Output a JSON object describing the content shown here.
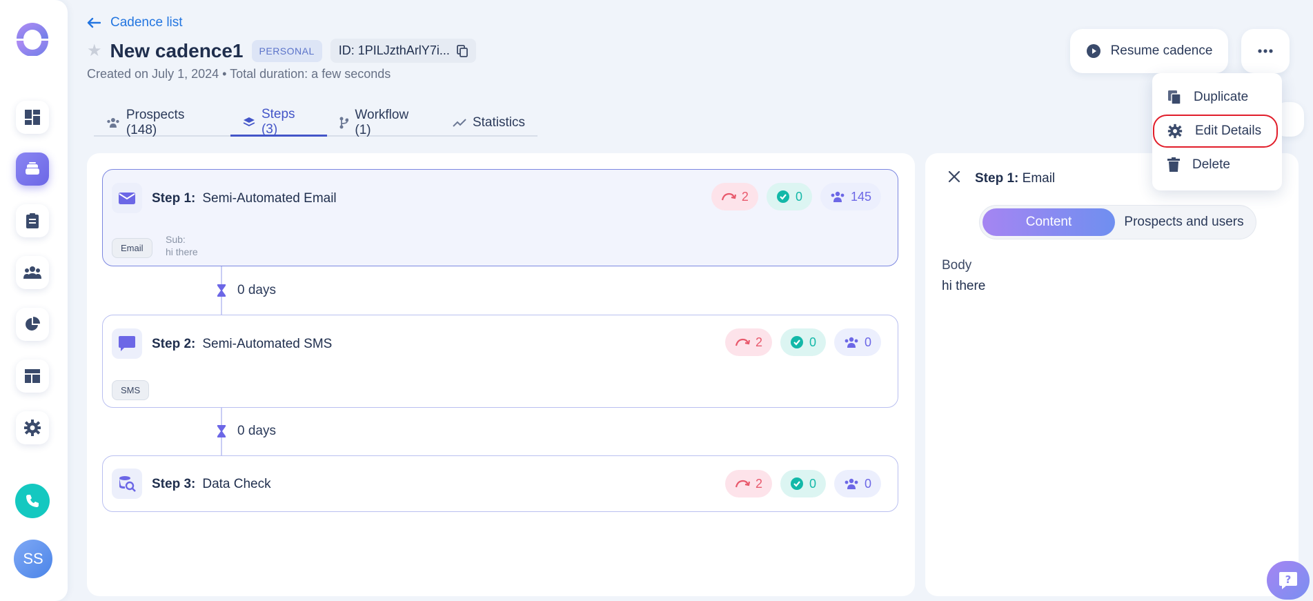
{
  "header": {
    "back_label": "Cadence list",
    "title": "New cadence1",
    "badge": "PERSONAL",
    "id_label": "ID: 1PILJzthArlY7i...",
    "subline": "Created on July 1, 2024 • Total duration: a few seconds"
  },
  "tabs": [
    {
      "label": "Prospects (148)",
      "icon": "prospects-icon"
    },
    {
      "label": "Steps (3)",
      "icon": "layers-icon",
      "active": true
    },
    {
      "label": "Workflow (1)",
      "icon": "workflow-icon"
    },
    {
      "label": "Statistics",
      "icon": "trend-icon"
    }
  ],
  "steps": [
    {
      "prefix": "Step 1:",
      "name": "Semi-Automated Email",
      "bounced": "2",
      "completed": "0",
      "prospects": "145",
      "chip": "Email",
      "sub_label": "Sub:",
      "sub_value": "hi there",
      "selected": true
    },
    {
      "prefix": "Step 2:",
      "name": "Semi-Automated SMS",
      "bounced": "2",
      "completed": "0",
      "prospects": "0",
      "chip": "SMS"
    },
    {
      "prefix": "Step 3:",
      "name": "Data Check",
      "bounced": "2",
      "completed": "0",
      "prospects": "0"
    }
  ],
  "waits": [
    "0 days",
    "0 days"
  ],
  "detail": {
    "prefix": "Step 1:",
    "type": "Email",
    "tab_content": "Content",
    "tab_prospects": "Prospects and users",
    "body_label": "Body",
    "body_text": "hi there"
  },
  "actions": {
    "resume_label": "Resume cadence"
  },
  "menu": {
    "duplicate": "Duplicate",
    "edit_details": "Edit Details",
    "delete": "Delete"
  },
  "user": {
    "initials": "SS"
  },
  "colors": {
    "accent": "#4355c8",
    "link": "#2275e0",
    "primary_gradient_start": "#a585f2",
    "primary_gradient_end": "#6f8ff0",
    "bounced": "#e8596c",
    "completed": "#13b8a8",
    "highlight": "#e11d2a"
  }
}
